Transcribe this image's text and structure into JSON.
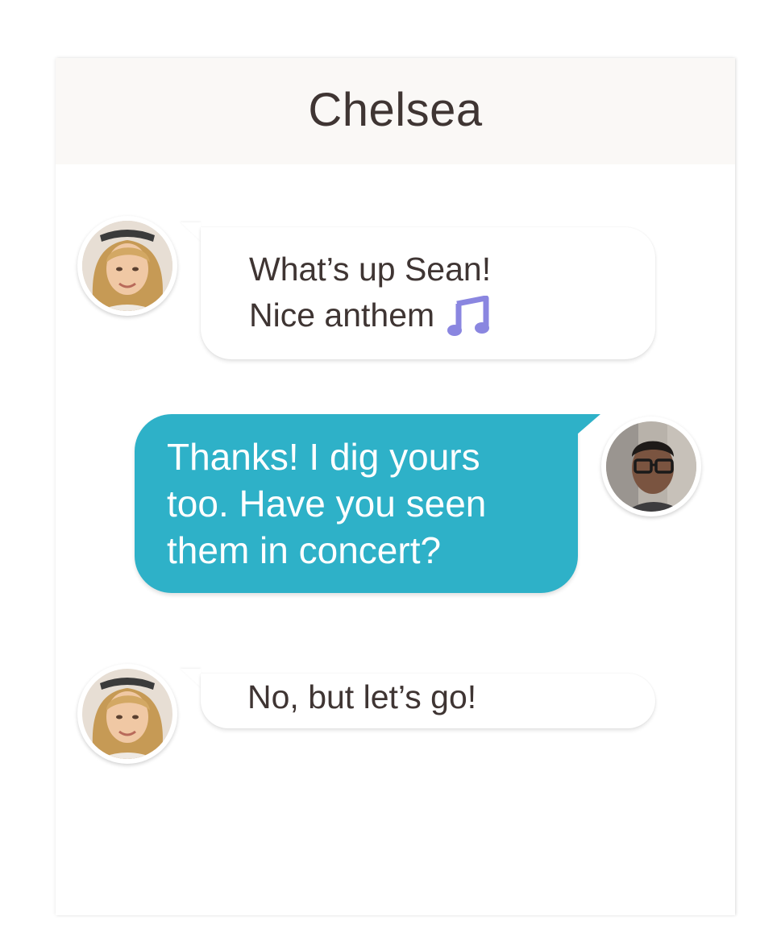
{
  "conversation": {
    "contact_name": "Chelsea"
  },
  "messages": [
    {
      "sender": "Chelsea",
      "direction": "incoming",
      "line1": "What’s up Sean!",
      "line2": "Nice anthem",
      "emoji": "musical-notes-icon"
    },
    {
      "sender": "Sean",
      "direction": "outgoing",
      "text": "Thanks! I dig yours\ntoo. Have you seen\nthem in concert?"
    },
    {
      "sender": "Chelsea",
      "direction": "incoming",
      "text": "No, but let’s go!"
    }
  ],
  "colors": {
    "header_bg": "#faf8f6",
    "incoming_bubble": "#ffffff",
    "outgoing_bubble": "#2eb1c8",
    "text_dark": "#3f3533",
    "emoji_purple": "#8a86e0"
  }
}
